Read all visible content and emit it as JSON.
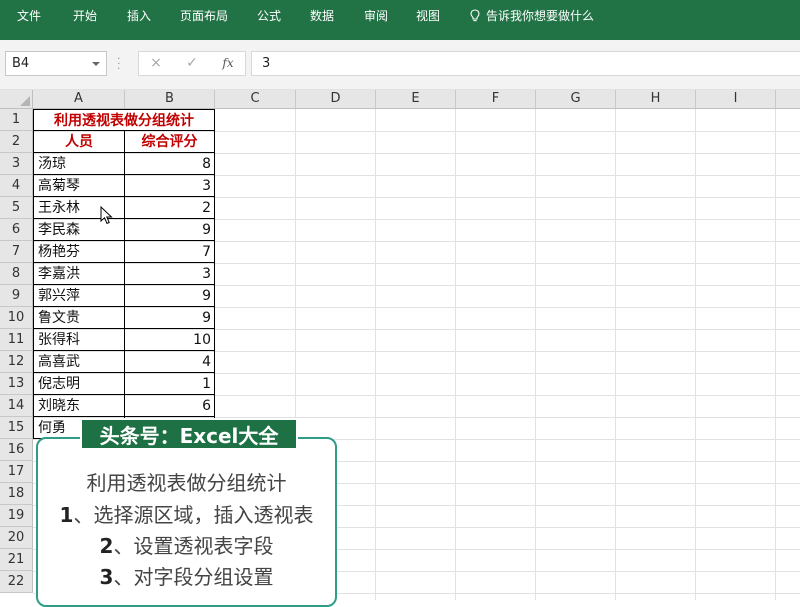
{
  "ribbon": {
    "tabs": [
      "文件",
      "开始",
      "插入",
      "页面布局",
      "公式",
      "数据",
      "审阅",
      "视图"
    ],
    "tell_me": "告诉我你想要做什么",
    "tell_me_icon": "lightbulb-icon"
  },
  "formula_bar": {
    "name_box": "B4",
    "cancel_icon": "×",
    "enter_icon": "✓",
    "fx_label": "fx",
    "value": "3"
  },
  "columns": [
    "A",
    "B",
    "C",
    "D",
    "E",
    "F",
    "G",
    "H",
    "I"
  ],
  "rows": [
    "1",
    "2",
    "3",
    "4",
    "5",
    "6",
    "7",
    "8",
    "9",
    "10",
    "11",
    "12",
    "13",
    "14",
    "15",
    "16",
    "17",
    "18",
    "19",
    "20",
    "21",
    "22"
  ],
  "table": {
    "title": "利用透视表做分组统计",
    "headers": [
      "人员",
      "综合评分"
    ],
    "records": [
      {
        "name": "汤琼",
        "score": "8"
      },
      {
        "name": "高菊琴",
        "score": "3"
      },
      {
        "name": "王永林",
        "score": "2"
      },
      {
        "name": "李民森",
        "score": "9"
      },
      {
        "name": "杨艳芬",
        "score": "7"
      },
      {
        "name": "李嘉洪",
        "score": "3"
      },
      {
        "name": "郭兴萍",
        "score": "9"
      },
      {
        "name": "鲁文贵",
        "score": "9"
      },
      {
        "name": "张得科",
        "score": "10"
      },
      {
        "name": "高喜武",
        "score": "4"
      },
      {
        "name": "倪志明",
        "score": "1"
      },
      {
        "name": "刘晓东",
        "score": "6"
      },
      {
        "name": "何勇",
        "score": ""
      }
    ]
  },
  "watermark": "头条号：Excel大全",
  "card": {
    "title": "利用透视表做分组统计",
    "steps": [
      {
        "num": "1",
        "text": "、选择源区域，插入透视表"
      },
      {
        "num": "2",
        "text": "、设置透视表字段"
      },
      {
        "num": "3",
        "text": "、对字段分组设置"
      }
    ]
  },
  "colors": {
    "ribbon": "#217346",
    "header_text": "#c00000",
    "badge": "#1e7145",
    "card_border": "#2f9d87"
  }
}
